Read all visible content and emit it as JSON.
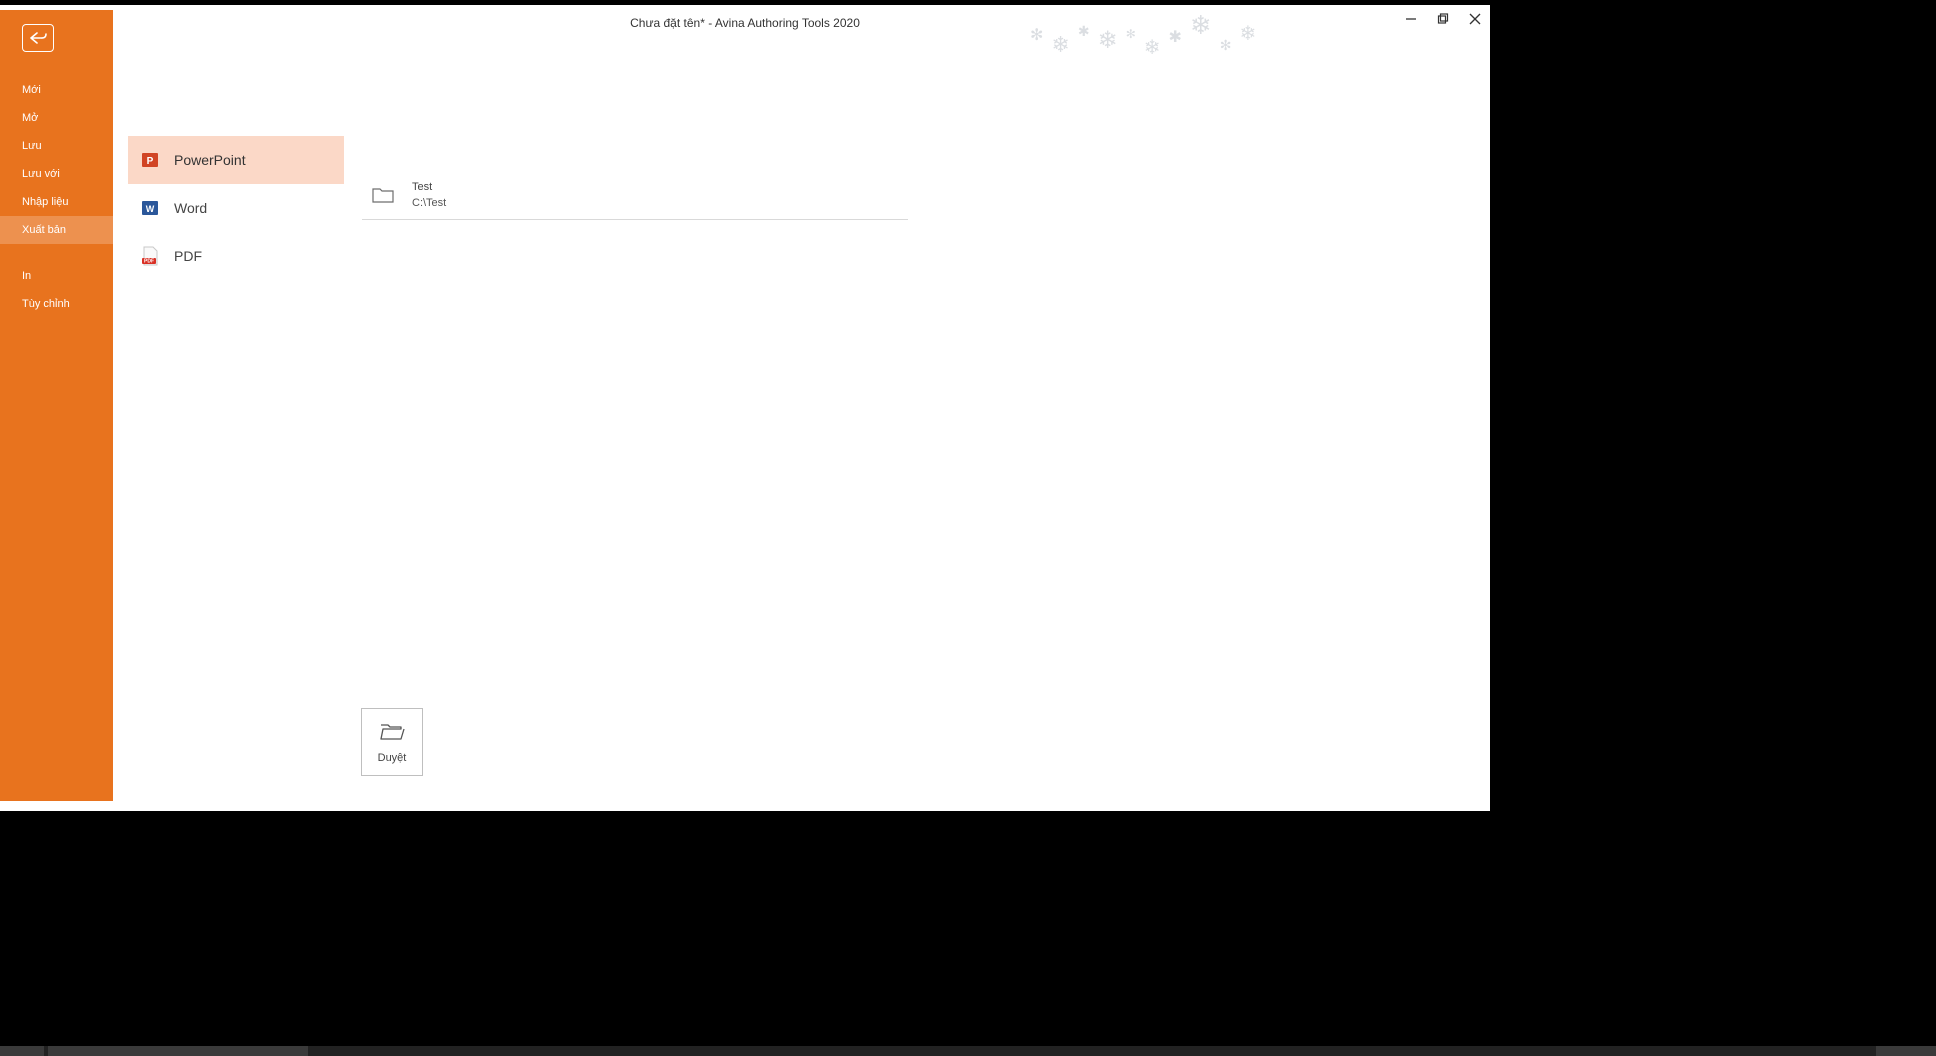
{
  "window": {
    "title": "Chưa đặt tên* - Avina Authoring Tools 2020"
  },
  "sidebar": {
    "items": [
      {
        "id": "new",
        "label": "Mới"
      },
      {
        "id": "open",
        "label": "Mở"
      },
      {
        "id": "save",
        "label": "Lưu"
      },
      {
        "id": "saveas",
        "label": "Lưu với"
      },
      {
        "id": "import",
        "label": "Nhập liệu"
      },
      {
        "id": "publish",
        "label": "Xuất bản",
        "selected": true
      },
      {
        "id": "gap"
      },
      {
        "id": "print",
        "label": "In"
      },
      {
        "id": "options",
        "label": "Tùy chỉnh"
      }
    ]
  },
  "formats": {
    "items": [
      {
        "id": "powerpoint",
        "label": "PowerPoint",
        "icon": "powerpoint-icon",
        "color": "#d14424",
        "selected": true
      },
      {
        "id": "word",
        "label": "Word",
        "icon": "word-icon",
        "color": "#2b579a"
      },
      {
        "id": "pdf",
        "label": "PDF",
        "icon": "pdf-icon",
        "color": "#d93025"
      }
    ]
  },
  "destinations": {
    "items": [
      {
        "name": "Test",
        "path": "C:\\Test"
      }
    ]
  },
  "browse": {
    "label": "Duyệt"
  }
}
